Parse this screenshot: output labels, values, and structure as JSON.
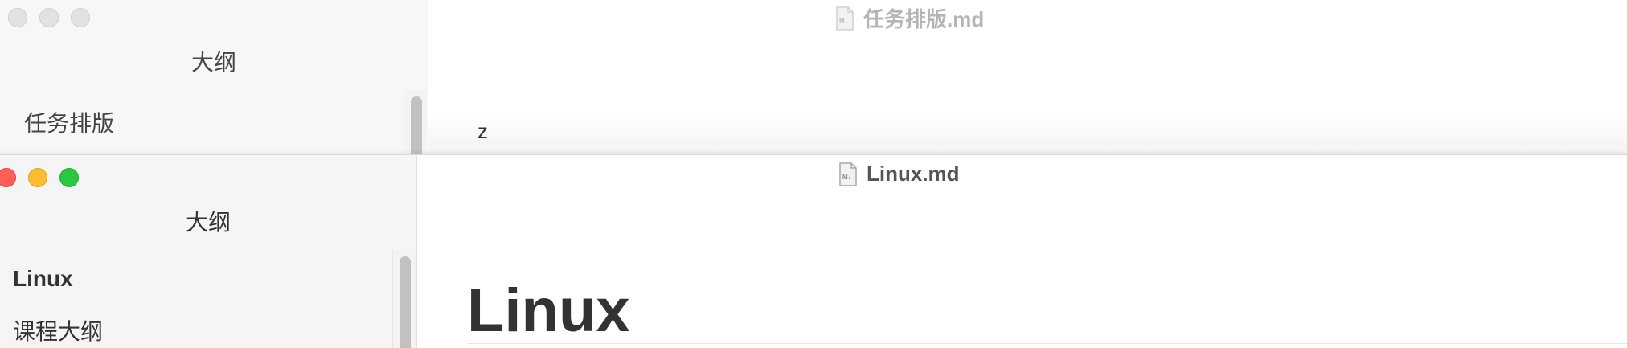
{
  "back_window": {
    "title": "任务排版.md",
    "file_icon": "markdown-file-icon",
    "outline_title": "大纲",
    "outline_items": [
      "任务排版"
    ],
    "editor_text": "z",
    "traffic_lights": "inactive"
  },
  "front_window": {
    "title": "Linux.md",
    "file_icon": "markdown-file-icon",
    "outline_title": "大纲",
    "outline_items": [
      {
        "label": "Linux",
        "level": 1
      },
      {
        "label": "课程大纲",
        "level": 2
      }
    ],
    "heading": "Linux",
    "traffic_lights": "active"
  },
  "colors": {
    "close": "#fe5f57",
    "minimize": "#febc2e",
    "zoom": "#28c840",
    "sidebar_bg": "#f5f5f5",
    "text": "#333333"
  }
}
